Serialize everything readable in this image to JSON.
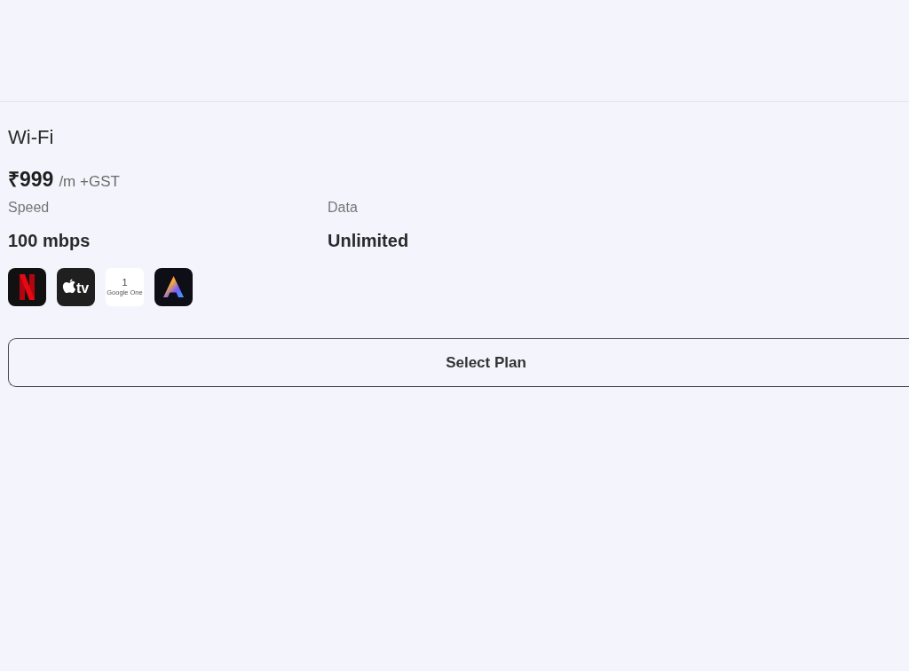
{
  "plan": {
    "title": "Wi-Fi",
    "price": "₹999",
    "price_suffix": "/m +GST",
    "specs": [
      {
        "label": "Speed",
        "value": "100 mbps"
      },
      {
        "label": "Data",
        "value": "Unlimited"
      }
    ],
    "apps": [
      {
        "kind": "netflix"
      },
      {
        "kind": "appletv",
        "text": "tv"
      },
      {
        "kind": "googleone",
        "text": "1",
        "caption": "Google One"
      },
      {
        "kind": "adobe"
      }
    ],
    "button": "Select Plan"
  }
}
